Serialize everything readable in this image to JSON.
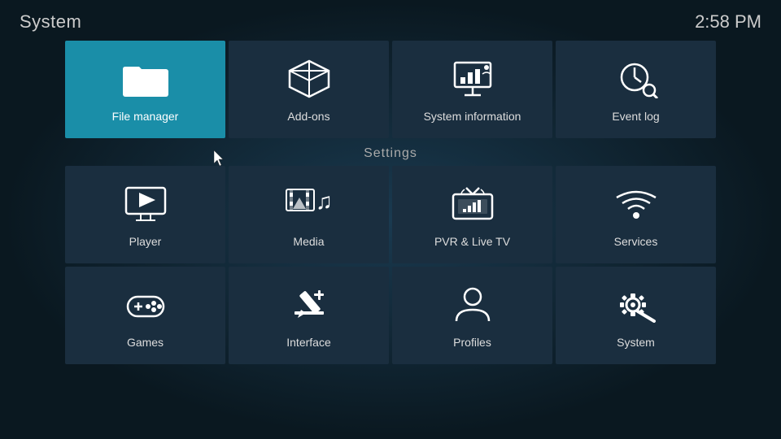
{
  "header": {
    "title": "System",
    "time": "2:58 PM"
  },
  "top_tiles": [
    {
      "id": "file-manager",
      "label": "File manager",
      "active": true,
      "icon": "folder"
    },
    {
      "id": "add-ons",
      "label": "Add-ons",
      "active": false,
      "icon": "addons"
    },
    {
      "id": "system-information",
      "label": "System information",
      "active": false,
      "icon": "sysinfo"
    },
    {
      "id": "event-log",
      "label": "Event log",
      "active": false,
      "icon": "eventlog"
    }
  ],
  "settings_label": "Settings",
  "settings_tiles": [
    [
      {
        "id": "player",
        "label": "Player",
        "icon": "player"
      },
      {
        "id": "media",
        "label": "Media",
        "icon": "media"
      },
      {
        "id": "pvr-live-tv",
        "label": "PVR & Live TV",
        "icon": "pvr"
      },
      {
        "id": "services",
        "label": "Services",
        "icon": "services"
      }
    ],
    [
      {
        "id": "games",
        "label": "Games",
        "icon": "games"
      },
      {
        "id": "interface",
        "label": "Interface",
        "icon": "interface"
      },
      {
        "id": "profiles",
        "label": "Profiles",
        "icon": "profiles"
      },
      {
        "id": "system",
        "label": "System",
        "icon": "system"
      }
    ]
  ]
}
